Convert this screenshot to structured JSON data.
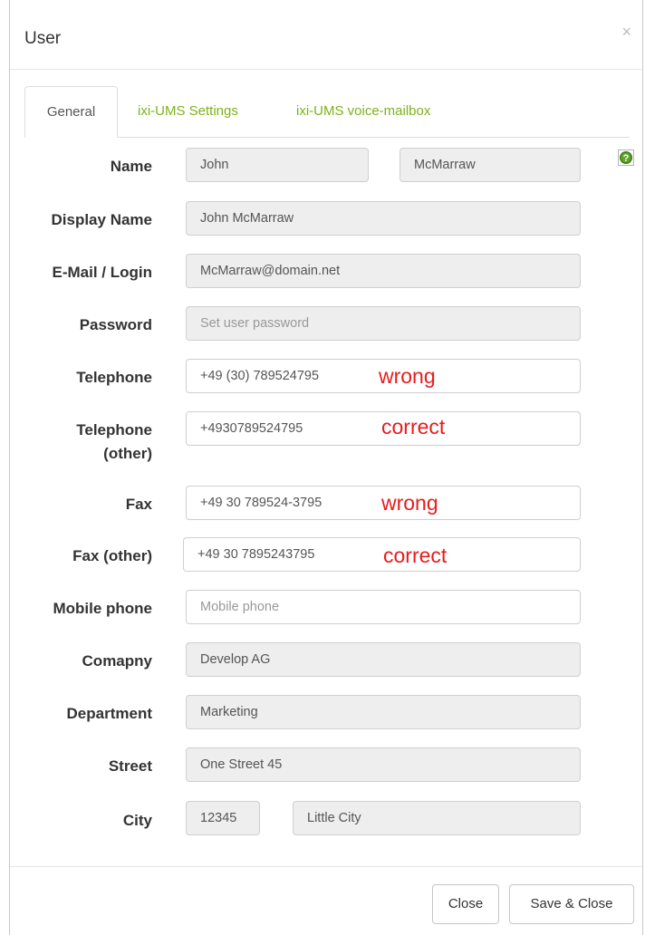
{
  "dialog": {
    "title": "User",
    "close_glyph": "×"
  },
  "tabs": [
    {
      "label": "General",
      "active": true
    },
    {
      "label": "ixi-UMS Settings",
      "active": false
    },
    {
      "label": "ixi-UMS voice-mailbox",
      "active": false
    }
  ],
  "colors": {
    "tab_link": "#7bb31a",
    "annotation": "#e81c1c",
    "readonly_bg": "#eeeeee"
  },
  "icons": {
    "help": "help-circle-icon"
  },
  "form": {
    "name": {
      "label": "Name",
      "first": "John",
      "last": "McMarraw"
    },
    "display_name": {
      "label": "Display Name",
      "value": "John McMarraw"
    },
    "email": {
      "label": "E-Mail / Login",
      "value": "McMarraw@domain.net"
    },
    "password": {
      "label": "Password",
      "placeholder": "Set user password"
    },
    "telephone": {
      "label": "Telephone",
      "value": "+49 (30) 789524795",
      "note": "wrong"
    },
    "telephone_other": {
      "label_line1": "Telephone",
      "label_line2": "(other)",
      "value": "+4930789524795",
      "note": "correct"
    },
    "fax": {
      "label": "Fax",
      "value": "+49 30 789524-3795",
      "note": "wrong"
    },
    "fax_other": {
      "label": "Fax (other)",
      "value": "+49 30 7895243795",
      "note": "correct"
    },
    "mobile": {
      "label": "Mobile phone",
      "placeholder": "Mobile phone"
    },
    "company": {
      "label": "Comapny",
      "value": "Develop AG"
    },
    "department": {
      "label": "Department",
      "value": "Marketing"
    },
    "street": {
      "label": "Street",
      "value": "One Street 45"
    },
    "city": {
      "label": "City",
      "zip": "12345",
      "name": "Little City"
    }
  },
  "footer": {
    "close_label": "Close",
    "save_close_label": "Save & Close"
  }
}
